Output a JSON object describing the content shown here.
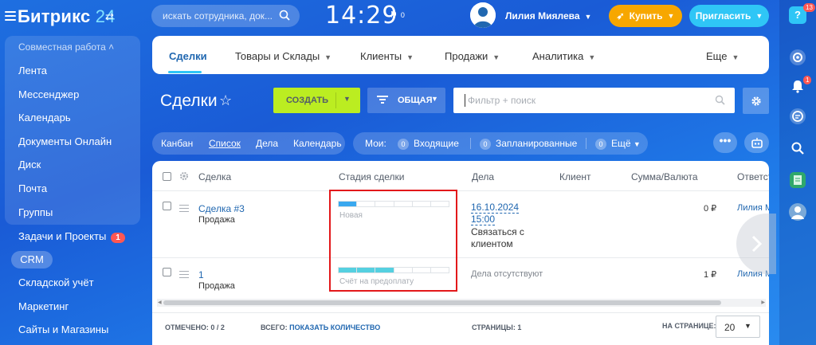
{
  "header": {
    "logo_text": "Битрикс",
    "logo_num": "24",
    "search_placeholder": "искать сотрудника, док...",
    "clock": "14:29",
    "flag_count": "0",
    "user_name": "Лилия Миялева",
    "buy_label": "Купить",
    "invite_label": "Пригласить"
  },
  "sidebar": {
    "group_title": "Совместная работа",
    "items": [
      {
        "label": "Лента"
      },
      {
        "label": "Мессенджер"
      },
      {
        "label": "Календарь"
      },
      {
        "label": "Документы Онлайн"
      },
      {
        "label": "Диск"
      },
      {
        "label": "Почта"
      },
      {
        "label": "Группы"
      }
    ],
    "tasks_label": "Задачи и Проекты",
    "tasks_badge": "1",
    "crm_label": "CRM",
    "after_items": [
      {
        "label": "Складской учёт"
      },
      {
        "label": "Маркетинг"
      },
      {
        "label": "Сайты и Магазины"
      }
    ]
  },
  "rail": {
    "help_badge": "13",
    "help_label": "?",
    "notify_badge": "1"
  },
  "topnav": {
    "tabs": [
      {
        "label": "Сделки"
      },
      {
        "label": "Товары и Склады"
      },
      {
        "label": "Клиенты"
      },
      {
        "label": "Продажи"
      },
      {
        "label": "Аналитика"
      },
      {
        "label": "Еще"
      }
    ]
  },
  "toolbar": {
    "page_title": "Сделки",
    "create_label": "СОЗДАТЬ",
    "category_label": "ОБЩАЯ",
    "filter_placeholder": "Фильтр + поиск"
  },
  "views": {
    "items": [
      {
        "label": "Канбан"
      },
      {
        "label": "Список"
      },
      {
        "label": "Дела"
      },
      {
        "label": "Календарь"
      }
    ],
    "active": "Список"
  },
  "counters": {
    "title": "Мои:",
    "items": [
      {
        "value": "0",
        "label": "Входящие"
      },
      {
        "value": "0",
        "label": "Запланированные"
      },
      {
        "value": "0",
        "label": "Ещё"
      }
    ]
  },
  "grid": {
    "columns": [
      "Сделка",
      "Стадия сделки",
      "Дела",
      "Клиент",
      "Сумма/Валюта",
      "Ответст"
    ],
    "rows": [
      {
        "title": "Сделка #3",
        "type": "Продажа",
        "stage": "Новая",
        "stage_color": "#39a8ef",
        "stage_progress": 0.15,
        "activity_date": "16.10.2024",
        "activity_time": "15:00",
        "activity_line1": "Связаться с",
        "activity_line2": "клиентом",
        "amount": "0 ₽",
        "responsible": "Лилия М"
      },
      {
        "title": "1",
        "type": "Продажа",
        "stage": "Счёт на предоплату",
        "stage_color": "#55d0e0",
        "stage_progress": 0.5,
        "activity_none": "Дела отсутствуют",
        "amount": "1 ₽",
        "responsible": "Лилия М"
      }
    ]
  },
  "footer": {
    "selected_label": "ОТМЕЧЕНО:",
    "selected_value": "0 / 2",
    "total_label": "ВСЕГО:",
    "total_link": "ПОКАЗАТЬ КОЛИЧЕСТВО",
    "pages_label": "СТРАНИЦЫ:",
    "pages_value": "1",
    "per_page_label": "НА СТРАНИЦЕ:",
    "per_page_value": "20"
  },
  "colors": {
    "accent": "#2fc6f6",
    "create_button": "#bbed21",
    "buy_button": "#f7a700",
    "badge": "#ff5752",
    "highlight_box": "#e3181a"
  }
}
